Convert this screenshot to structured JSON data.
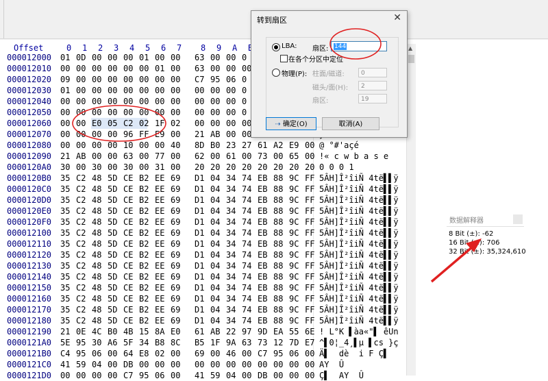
{
  "header": {
    "offset_label": "Offset",
    "columns": [
      "0",
      "1",
      "2",
      "3",
      "4",
      "5",
      "6",
      "7",
      "8",
      "9",
      "A",
      "B"
    ]
  },
  "rows": [
    {
      "offset": "000012000",
      "bytes": [
        "01",
        "0D",
        "00",
        "00",
        "00",
        "01",
        "00",
        "00",
        "63",
        "00",
        "00",
        "0"
      ],
      "text": ""
    },
    {
      "offset": "000012010",
      "bytes": [
        "00",
        "00",
        "00",
        "00",
        "00",
        "00",
        "01",
        "00",
        "63",
        "00",
        "00",
        "00"
      ],
      "text": ""
    },
    {
      "offset": "000012020",
      "bytes": [
        "09",
        "00",
        "00",
        "00",
        "00",
        "00",
        "00",
        "00",
        "C7",
        "95",
        "06",
        "0"
      ],
      "text": ""
    },
    {
      "offset": "000012030",
      "bytes": [
        "01",
        "00",
        "00",
        "00",
        "00",
        "00",
        "00",
        "00",
        "00",
        "00",
        "00",
        "0"
      ],
      "text": ""
    },
    {
      "offset": "000012040",
      "bytes": [
        "00",
        "00",
        "00",
        "00",
        "00",
        "00",
        "00",
        "00",
        "00",
        "00",
        "00",
        "0"
      ],
      "text": ""
    },
    {
      "offset": "000012050",
      "bytes": [
        "00",
        "00",
        "00",
        "00",
        "00",
        "00",
        "00",
        "00",
        "00",
        "00",
        "00",
        "0"
      ],
      "text": ""
    },
    {
      "offset": "000012060",
      "bytes": [
        "00",
        "00",
        "E0",
        "05",
        "C2",
        "02",
        "1F",
        "02",
        "00",
        "00",
        "00",
        "00"
      ],
      "text": ""
    },
    {
      "offset": "000012070",
      "bytes": [
        "00",
        "00",
        "00",
        "00",
        "96",
        "FF",
        "E9",
        "00",
        "21",
        "AB",
        "00",
        "00"
      ],
      "text": "y"
    },
    {
      "offset": "000012080",
      "bytes": [
        "00",
        "00",
        "00",
        "00",
        "10",
        "00",
        "00",
        "40",
        "8D",
        "B0",
        "23",
        "27",
        "61",
        "A2",
        "E9",
        "00"
      ],
      "text": "@ °#'açé"
    },
    {
      "offset": "000012090",
      "bytes": [
        "21",
        "AB",
        "00",
        "00",
        "63",
        "00",
        "77",
        "00",
        "62",
        "00",
        "61",
        "00",
        "73",
        "00",
        "65",
        "00"
      ],
      "text": "!« c w b a s e"
    },
    {
      "offset": "0000120A0",
      "bytes": [
        "30",
        "00",
        "30",
        "00",
        "30",
        "00",
        "31",
        "00",
        "20",
        "20",
        "20",
        "20",
        "20",
        "20",
        "20",
        "20"
      ],
      "text": "0 0 0 1"
    },
    {
      "offset": "0000120B0",
      "bytes": [
        "35",
        "C2",
        "48",
        "5D",
        "CE",
        "B2",
        "EE",
        "69",
        "D1",
        "04",
        "34",
        "74",
        "EB",
        "88",
        "9C",
        "FF"
      ],
      "text": "5ÂH]Î²îiÑ 4të▌▌ÿ"
    },
    {
      "offset": "0000120C0",
      "bytes": [
        "35",
        "C2",
        "48",
        "5D",
        "CE",
        "B2",
        "EE",
        "69",
        "D1",
        "04",
        "34",
        "74",
        "EB",
        "88",
        "9C",
        "FF"
      ],
      "text": "5ÂH]Î²îiÑ 4të▌▌ÿ"
    },
    {
      "offset": "0000120D0",
      "bytes": [
        "35",
        "C2",
        "48",
        "5D",
        "CE",
        "B2",
        "EE",
        "69",
        "D1",
        "04",
        "34",
        "74",
        "EB",
        "88",
        "9C",
        "FF"
      ],
      "text": "5ÂH]Î²îiÑ 4të▌▌ÿ"
    },
    {
      "offset": "0000120E0",
      "bytes": [
        "35",
        "C2",
        "48",
        "5D",
        "CE",
        "B2",
        "EE",
        "69",
        "D1",
        "04",
        "34",
        "74",
        "EB",
        "88",
        "9C",
        "FF"
      ],
      "text": "5ÂH]Î²îiÑ 4të▌▌ÿ"
    },
    {
      "offset": "0000120F0",
      "bytes": [
        "35",
        "C2",
        "48",
        "5D",
        "CE",
        "B2",
        "EE",
        "69",
        "D1",
        "04",
        "34",
        "74",
        "EB",
        "88",
        "9C",
        "FF"
      ],
      "text": "5ÂH]Î²îiÑ 4të▌▌ÿ"
    },
    {
      "offset": "000012100",
      "bytes": [
        "35",
        "C2",
        "48",
        "5D",
        "CE",
        "B2",
        "EE",
        "69",
        "D1",
        "04",
        "34",
        "74",
        "EB",
        "88",
        "9C",
        "FF"
      ],
      "text": "5ÂH]Î²îiÑ 4të▌▌ÿ"
    },
    {
      "offset": "000012110",
      "bytes": [
        "35",
        "C2",
        "48",
        "5D",
        "CE",
        "B2",
        "EE",
        "69",
        "D1",
        "04",
        "34",
        "74",
        "EB",
        "88",
        "9C",
        "FF"
      ],
      "text": "5ÂH]Î²îiÑ 4të▌▌ÿ"
    },
    {
      "offset": "000012120",
      "bytes": [
        "35",
        "C2",
        "48",
        "5D",
        "CE",
        "B2",
        "EE",
        "69",
        "D1",
        "04",
        "34",
        "74",
        "EB",
        "88",
        "9C",
        "FF"
      ],
      "text": "5ÂH]Î²îiÑ 4të▌▌ÿ"
    },
    {
      "offset": "000012130",
      "bytes": [
        "35",
        "C2",
        "48",
        "5D",
        "CE",
        "B2",
        "EE",
        "69",
        "D1",
        "04",
        "34",
        "74",
        "EB",
        "88",
        "9C",
        "FF"
      ],
      "text": "5ÂH]Î²îiÑ 4të▌▌ÿ"
    },
    {
      "offset": "000012140",
      "bytes": [
        "35",
        "C2",
        "48",
        "5D",
        "CE",
        "B2",
        "EE",
        "69",
        "D1",
        "04",
        "34",
        "74",
        "EB",
        "88",
        "9C",
        "FF"
      ],
      "text": "5ÂH]Î²îiÑ 4të▌▌ÿ"
    },
    {
      "offset": "000012150",
      "bytes": [
        "35",
        "C2",
        "48",
        "5D",
        "CE",
        "B2",
        "EE",
        "69",
        "D1",
        "04",
        "34",
        "74",
        "EB",
        "88",
        "9C",
        "FF"
      ],
      "text": "5ÂH]Î²îiÑ 4të▌▌ÿ"
    },
    {
      "offset": "000012160",
      "bytes": [
        "35",
        "C2",
        "48",
        "5D",
        "CE",
        "B2",
        "EE",
        "69",
        "D1",
        "04",
        "34",
        "74",
        "EB",
        "88",
        "9C",
        "FF"
      ],
      "text": "5ÂH]Î²îiÑ 4të▌▌ÿ"
    },
    {
      "offset": "000012170",
      "bytes": [
        "35",
        "C2",
        "48",
        "5D",
        "CE",
        "B2",
        "EE",
        "69",
        "D1",
        "04",
        "34",
        "74",
        "EB",
        "88",
        "9C",
        "FF"
      ],
      "text": "5ÂH]Î²îiÑ 4të▌▌ÿ"
    },
    {
      "offset": "000012180",
      "bytes": [
        "35",
        "C2",
        "48",
        "5D",
        "CE",
        "B2",
        "EE",
        "69",
        "D1",
        "04",
        "34",
        "74",
        "EB",
        "88",
        "9C",
        "FF"
      ],
      "text": "5ÂH]Î²îiÑ 4të▌▌ÿ"
    },
    {
      "offset": "000012190",
      "bytes": [
        "21",
        "0E",
        "4C",
        "B0",
        "4B",
        "15",
        "8A",
        "E0",
        "61",
        "AB",
        "22",
        "97",
        "9D",
        "EA",
        "55",
        "6E"
      ],
      "text": "! L°K ▌àa«\"▌ êUn"
    },
    {
      "offset": "0000121A0",
      "bytes": [
        "5E",
        "95",
        "30",
        "A6",
        "5F",
        "34",
        "B8",
        "8C",
        "B5",
        "1F",
        "9A",
        "63",
        "73",
        "12",
        "7D",
        "E7"
      ],
      "text": "^▌0¦_4¸▌µ ▌cs }ç"
    },
    {
      "offset": "0000121B0",
      "bytes": [
        "C4",
        "95",
        "06",
        "00",
        "64",
        "E8",
        "02",
        "00",
        "69",
        "00",
        "46",
        "00",
        "C7",
        "95",
        "06",
        "00"
      ],
      "text": "Ä▌  dè  i F Ç▌"
    },
    {
      "offset": "0000121C0",
      "bytes": [
        "41",
        "59",
        "04",
        "00",
        "DB",
        "00",
        "00",
        "00",
        "00",
        "00",
        "00",
        "00",
        "00",
        "00",
        "00",
        "00"
      ],
      "text": "AY  Û"
    },
    {
      "offset": "0000121D0",
      "bytes": [
        "00",
        "00",
        "00",
        "00",
        "C7",
        "95",
        "06",
        "00",
        "41",
        "59",
        "04",
        "00",
        "DB",
        "00",
        "00",
        "00"
      ],
      "text": "Ç▌  AY  Û"
    }
  ],
  "goto_dialog": {
    "title": "转到扇区",
    "close": "✕",
    "lba_label": "LBA:",
    "sector_label": "扇区:",
    "sector_value": "144",
    "partition_checkbox": "在各个分区中定位",
    "physical_label": "物理(P):",
    "cyl_label": "柱面/磁道:",
    "cyl_value": "0",
    "head_label": "磁头/面(H):",
    "head_value": "2",
    "sec_label": "扇区:",
    "sec_value": "19",
    "ok_label": "确定(O)",
    "cancel_label": "取消(A)"
  },
  "interpreter": {
    "title": "数据解释器",
    "bit8_label": "8 Bit (±):",
    "bit8_value": "-62",
    "bit16_label": "16 Bit (±):",
    "bit16_value": "706",
    "bit32_label": "32 Bit (±):",
    "bit32_value": "35,324,610"
  },
  "annotation_color": "#e02020",
  "scroll_arrow": "▲"
}
